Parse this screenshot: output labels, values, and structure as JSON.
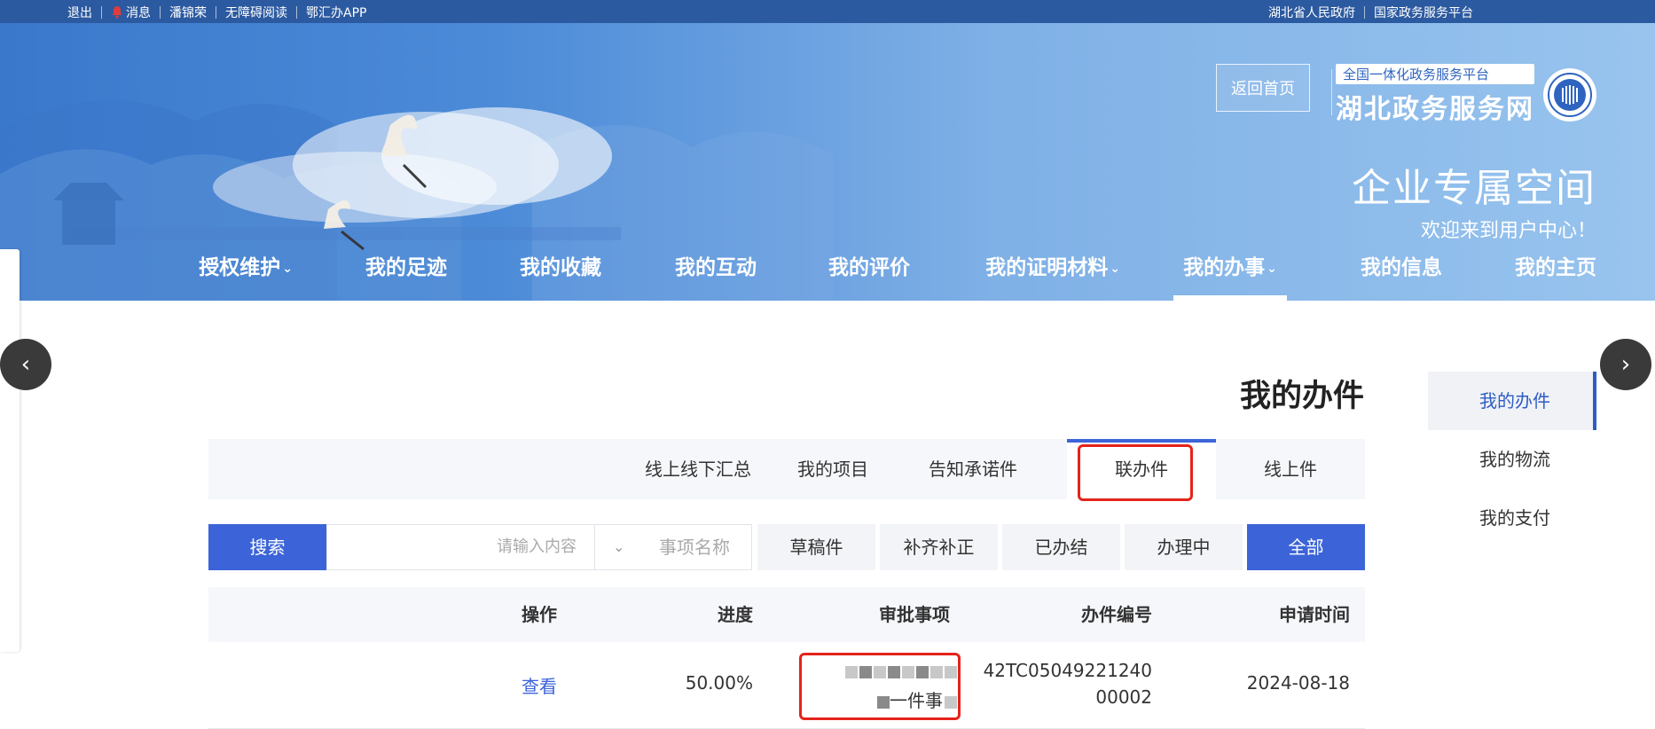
{
  "topbar": {
    "left_links": [
      "国家政务服务平台",
      "湖北省人民政府"
    ],
    "right_links": [
      "鄂汇办APP",
      "无障碍阅读",
      "潘锦荣",
      "消息",
      "退出"
    ]
  },
  "header": {
    "logo_sub": "全国一体化政务服务平台",
    "logo_main": "湖北政务服务网",
    "home_button": "返回首页",
    "title": "企业专属空间",
    "welcome": "欢迎来到用户中心！"
  },
  "nav": {
    "items": [
      "我的主页",
      "我的信息",
      "我的办事",
      "我的证明材料",
      "我的评价",
      "我的互动",
      "我的收藏",
      "我的足迹",
      "授权维护"
    ]
  },
  "sidebar": {
    "items": [
      "我的办件",
      "我的物流",
      "我的支付"
    ]
  },
  "content": {
    "page_title": "我的办件",
    "subtabs": [
      "线上件",
      "联办件",
      "告知承诺件",
      "我的项目",
      "线上线下汇总"
    ],
    "filters": [
      "全部",
      "办理中",
      "已办结",
      "补齐补正",
      "草稿件"
    ],
    "search": {
      "select_value": "事项名称",
      "placeholder": "请输入内容",
      "button": "搜索"
    },
    "table": {
      "headers": [
        "申请时间",
        "办件编号",
        "审批事项",
        "进度",
        "操作"
      ],
      "rows": [
        {
          "date": "2024-08-18",
          "code_line1": "42TC05049221240",
          "code_line2": "00002",
          "item_suffix": "一件事",
          "progress": "50.00%",
          "action": "查看"
        }
      ]
    }
  },
  "colors": {
    "primary": "#3c64d8",
    "banner": "#4c8bd8",
    "topbar": "#2c5aa0",
    "highlight": "#e5231a"
  }
}
